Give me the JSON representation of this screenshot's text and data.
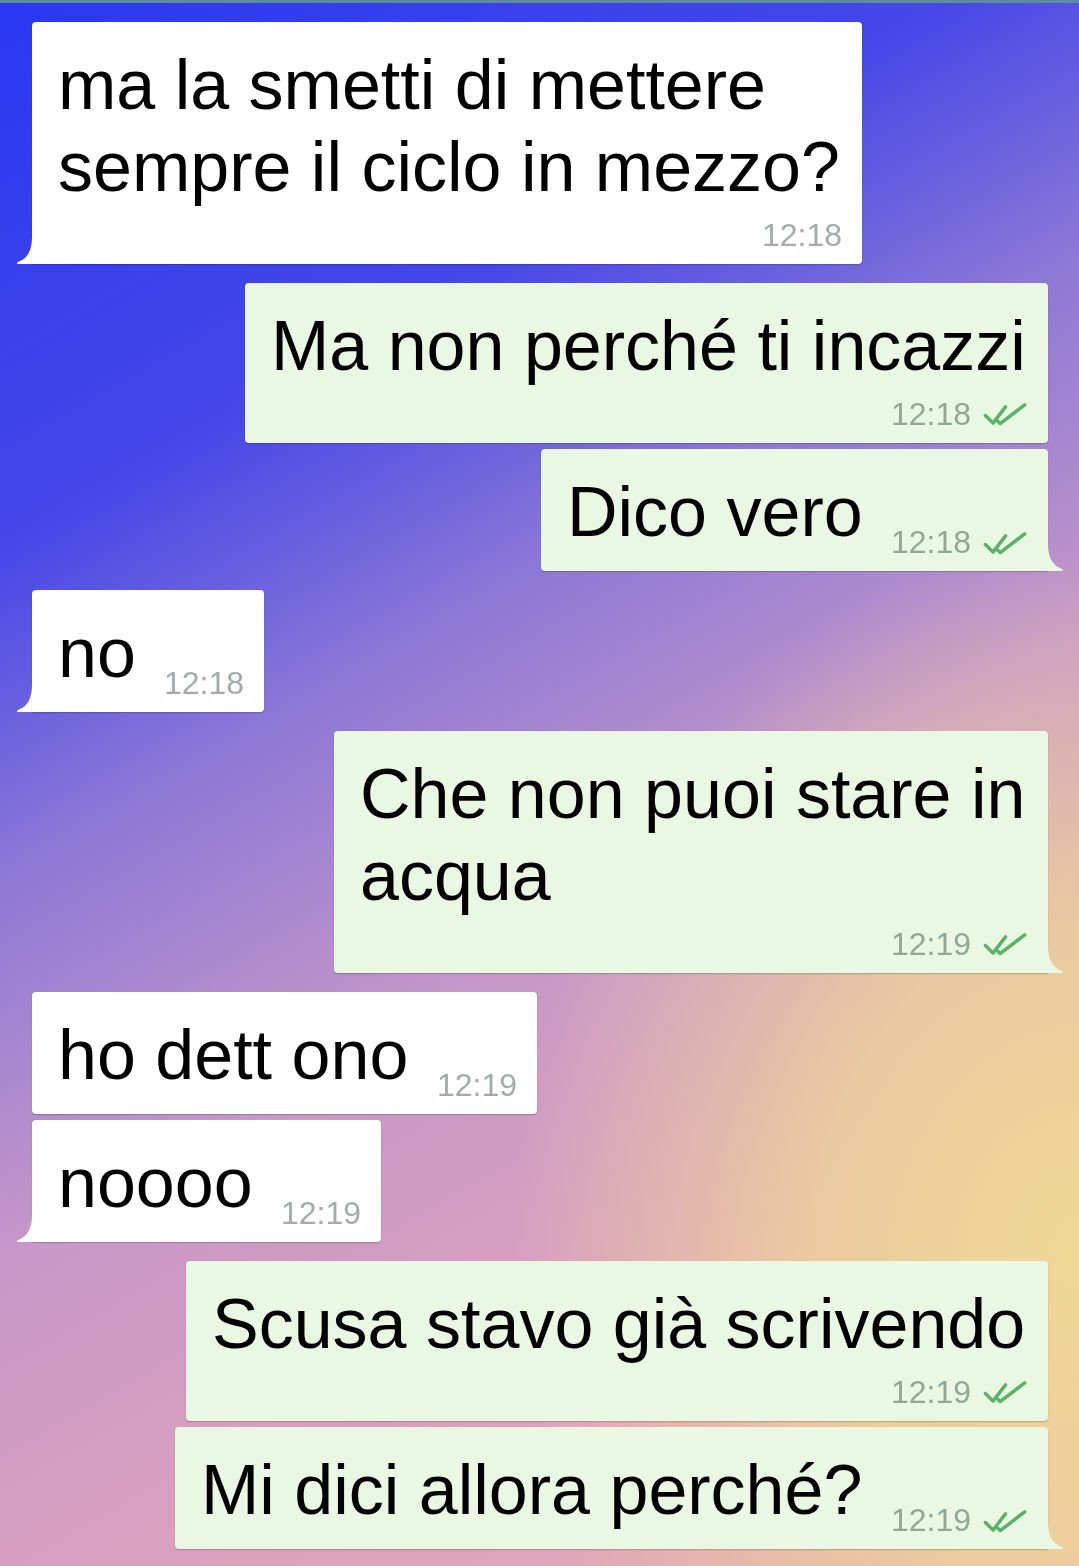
{
  "messages": [
    {
      "kind": "incoming",
      "text": "ma la smetti di mettere sempre il ciclo in mezzo?",
      "time": "12:18",
      "tail": true
    },
    {
      "kind": "outgoing",
      "text": "Ma non perché ti incazzi",
      "time": "12:18",
      "read": true,
      "tail": false
    },
    {
      "kind": "outgoing",
      "text": "Dico vero",
      "time": "12:18",
      "read": true,
      "tail": true
    },
    {
      "kind": "incoming",
      "text": "no",
      "time": "12:18",
      "tail": true
    },
    {
      "kind": "outgoing",
      "text": "Che non puoi stare in acqua",
      "time": "12:19",
      "read": true,
      "tail": true
    },
    {
      "kind": "incoming",
      "text": "ho dett ono",
      "time": "12:19",
      "tail": false
    },
    {
      "kind": "incoming",
      "text": "noooo",
      "time": "12:19",
      "tail": true
    },
    {
      "kind": "outgoing",
      "text": "Scusa stavo già scrivendo",
      "time": "12:19",
      "read": true,
      "tail": false
    },
    {
      "kind": "outgoing",
      "text": "Mi dici allora perché?",
      "time": "12:19",
      "read": true,
      "tail": true
    }
  ]
}
